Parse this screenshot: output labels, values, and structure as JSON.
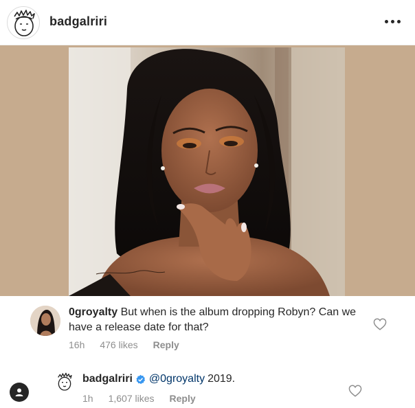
{
  "post": {
    "username": "badgalriri",
    "more_icon": "more-horizontal-icon",
    "photo_alt": "portrait photo"
  },
  "comments": [
    {
      "username": "0groyalty",
      "text": "But when is the album dropping Robyn? Can we have a release date for that?",
      "time": "16h",
      "likes": "476 likes",
      "reply": "Reply"
    },
    {
      "username": "badgalriri",
      "verified": true,
      "mention": "@0groyalty",
      "text": "2019.",
      "time": "1h",
      "likes": "1,607 likes",
      "reply": "Reply"
    }
  ],
  "colors": {
    "text": "#262626",
    "meta": "#8e8e8e",
    "verified": "#3897f0",
    "mention": "#003569"
  }
}
